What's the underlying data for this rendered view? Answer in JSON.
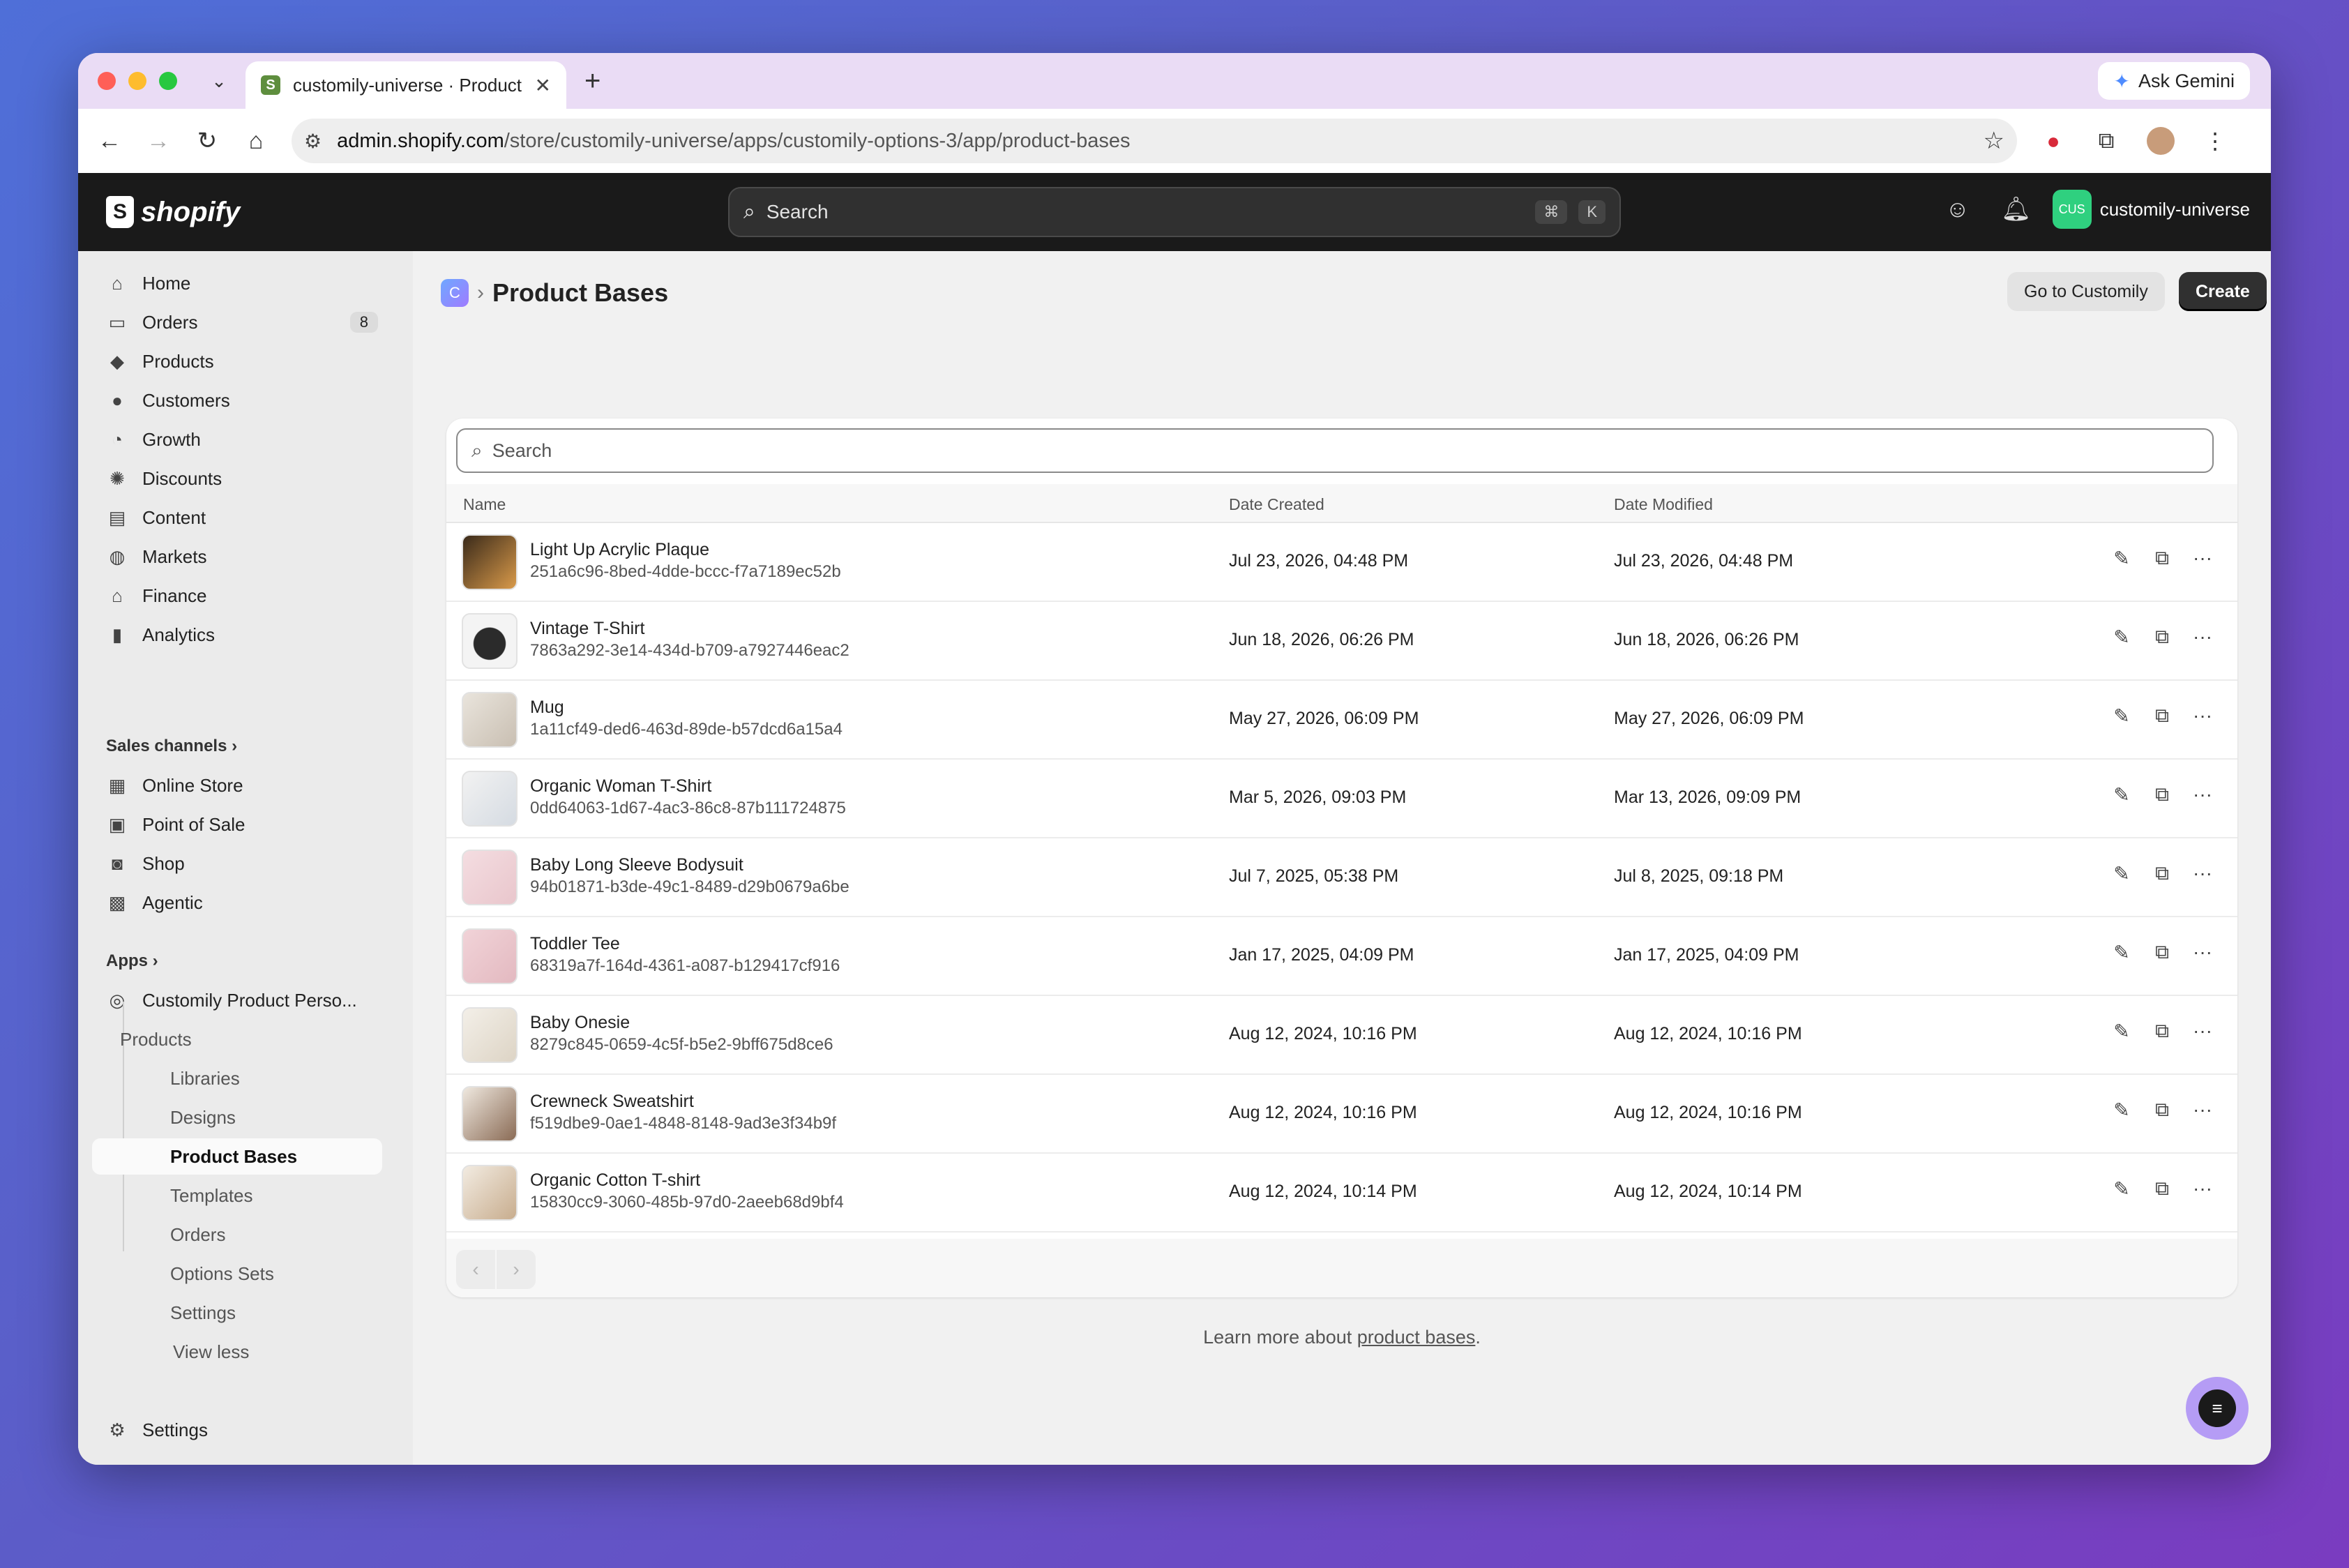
{
  "browser": {
    "tab_title": "customily-universe · Product",
    "tab_close": "✕",
    "new_tab": "+",
    "ask_gemini": "Ask Gemini",
    "url_host": "admin.shopify.com",
    "url_path": "/store/customily-universe/apps/customily-options-3/app/product-bases"
  },
  "topbar": {
    "logo_text": "shopify",
    "search_placeholder": "Search",
    "kbd_cmd": "⌘",
    "kbd_k": "K",
    "store_badge": "CUS",
    "store_name": "customily-universe"
  },
  "sidebar": {
    "items": [
      {
        "label": "Home"
      },
      {
        "label": "Orders",
        "count": "8"
      },
      {
        "label": "Products"
      },
      {
        "label": "Customers"
      },
      {
        "label": "Growth"
      },
      {
        "label": "Discounts"
      },
      {
        "label": "Content"
      },
      {
        "label": "Markets"
      },
      {
        "label": "Finance"
      },
      {
        "label": "Analytics"
      }
    ],
    "sales_channels_label": "Sales channels",
    "channels": [
      {
        "label": "Online Store"
      },
      {
        "label": "Point of Sale"
      },
      {
        "label": "Shop"
      },
      {
        "label": "Agentic"
      }
    ],
    "apps_label": "Apps",
    "app_name": "Customily Product Perso...",
    "app_subitems": [
      "Products",
      "Libraries",
      "Designs",
      "Product Bases",
      "Templates",
      "Orders",
      "Options Sets",
      "Settings"
    ],
    "view_less": "View less",
    "settings": "Settings"
  },
  "page": {
    "title": "Product Bases",
    "go_to_customily": "Go to Customily",
    "create": "Create",
    "search_placeholder": "Search",
    "columns": {
      "name": "Name",
      "date_created": "Date Created",
      "date_modified": "Date Modified"
    },
    "rows": [
      {
        "name": "Light Up Acrylic Plaque",
        "id": "251a6c96-8bed-4dde-bccc-f7a7189ec52b",
        "created": "Jul 23, 2026, 04:48 PM",
        "modified": "Jul 23, 2026, 04:48 PM"
      },
      {
        "name": "Vintage T-Shirt",
        "id": "7863a292-3e14-434d-b709-a7927446eac2",
        "created": "Jun 18, 2026, 06:26 PM",
        "modified": "Jun 18, 2026, 06:26 PM"
      },
      {
        "name": "Mug",
        "id": "1a11cf49-ded6-463d-89de-b57dcd6a15a4",
        "created": "May 27, 2026, 06:09 PM",
        "modified": "May 27, 2026, 06:09 PM"
      },
      {
        "name": "Organic Woman T-Shirt",
        "id": "0dd64063-1d67-4ac3-86c8-87b111724875",
        "created": "Mar 5, 2026, 09:03 PM",
        "modified": "Mar 13, 2026, 09:09 PM"
      },
      {
        "name": "Baby Long Sleeve Bodysuit",
        "id": "94b01871-b3de-49c1-8489-d29b0679a6be",
        "created": "Jul 7, 2025, 05:38 PM",
        "modified": "Jul 8, 2025, 09:18 PM"
      },
      {
        "name": "Toddler Tee",
        "id": "68319a7f-164d-4361-a087-b129417cf916",
        "created": "Jan 17, 2025, 04:09 PM",
        "modified": "Jan 17, 2025, 04:09 PM"
      },
      {
        "name": "Baby Onesie",
        "id": "8279c845-0659-4c5f-b5e2-9bff675d8ce6",
        "created": "Aug 12, 2024, 10:16 PM",
        "modified": "Aug 12, 2024, 10:16 PM"
      },
      {
        "name": "Crewneck Sweatshirt",
        "id": "f519dbe9-0ae1-4848-8148-9ad3e3f34b9f",
        "created": "Aug 12, 2024, 10:16 PM",
        "modified": "Aug 12, 2024, 10:16 PM"
      },
      {
        "name": "Organic Cotton T-shirt",
        "id": "15830cc9-3060-485b-97d0-2aeeb68d9bf4",
        "created": "Aug 12, 2024, 10:14 PM",
        "modified": "Aug 12, 2024, 10:14 PM"
      }
    ],
    "learn_prefix": "Learn more about ",
    "learn_link": "product bases",
    "learn_suffix": "."
  },
  "colors": {
    "accent_dark": "#303030",
    "topbar_bg": "#1a1a1a",
    "store_badge": "#2fd07f",
    "chat_fab": "#b59cf5"
  }
}
